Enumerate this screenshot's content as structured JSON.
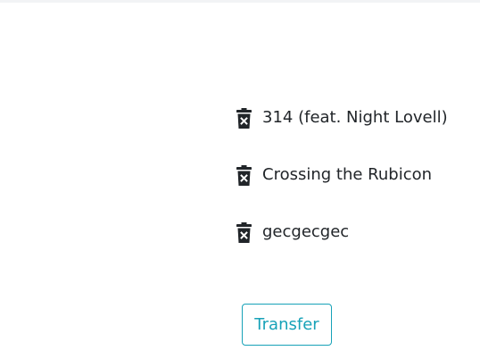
{
  "tracks": [
    {
      "name": "314 (feat. Night Lovell)",
      "icon": "trash-x-icon"
    },
    {
      "name": "Crossing the Rubicon",
      "icon": "trash-x-icon"
    },
    {
      "name": "gecgecgec",
      "icon": "trash-x-icon"
    }
  ],
  "actions": {
    "transfer_label": "Transfer"
  },
  "colors": {
    "accent": "#17a2b8",
    "text": "#212529",
    "icon": "#212529"
  }
}
